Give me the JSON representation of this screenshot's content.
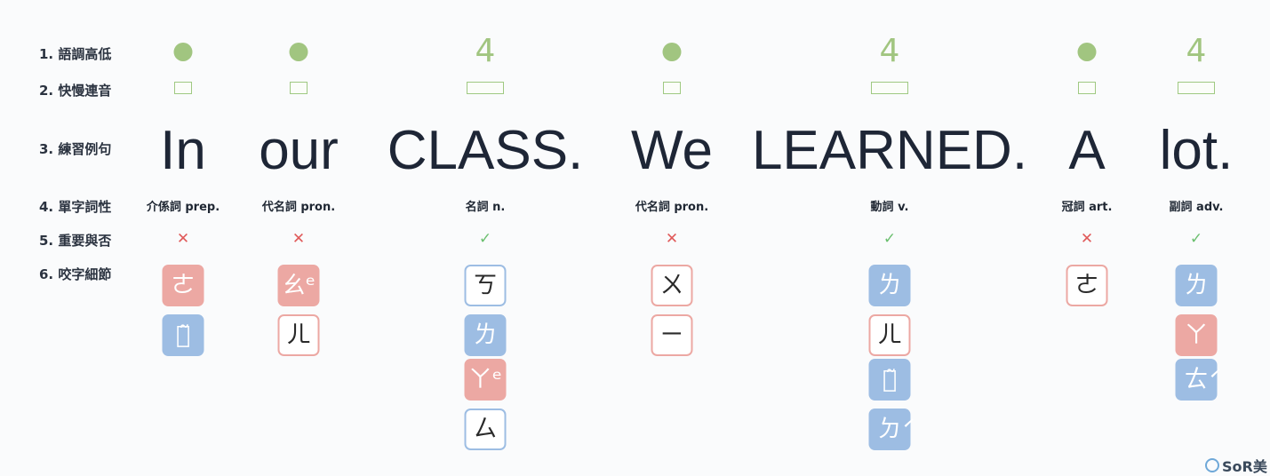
{
  "rows": [
    {
      "label": "1. 語調高低"
    },
    {
      "label": "2. 快慢連音"
    },
    {
      "label": "3. 練習例句"
    },
    {
      "label": "4. 單字詞性"
    },
    {
      "label": "5. 重要與否"
    },
    {
      "label": "6. 咬字細節"
    }
  ],
  "colors": {
    "green": "#a1c580",
    "pink": "#eca8a3",
    "blue": "#9dbde3",
    "cross": "#e05a5a",
    "check": "#6bbf6f"
  },
  "words": [
    {
      "word": "In",
      "tone": "dot",
      "pos": "介係詞 prep.",
      "important": false,
      "mark": "✕",
      "tiles": [
        {
          "char": "ㄜ",
          "style": "pink"
        },
        {
          "char": "ㄋ̃",
          "style": "blue"
        }
      ]
    },
    {
      "word": "our",
      "tone": "dot",
      "pos": "代名詞 pron.",
      "important": false,
      "mark": "✕",
      "tiles": [
        {
          "char": "ㄠᵉ",
          "style": "pink"
        },
        {
          "char": "ㄦ",
          "style": "out-pink"
        }
      ]
    },
    {
      "word": "CLASS.",
      "tone": "4",
      "pos": "名詞 n.",
      "important": true,
      "mark": "✓",
      "tiles": [
        {
          "char": "ㄎ",
          "style": "out-blue"
        },
        {
          "char": "ㄌ",
          "style": "blue"
        },
        {
          "char": "ㄚᵉ",
          "style": "pink"
        },
        {
          "char": "ㄙ",
          "style": "out-blue"
        }
      ]
    },
    {
      "word": "We",
      "tone": "dot",
      "pos": "代名詞 pron.",
      "important": false,
      "mark": "✕",
      "tiles": [
        {
          "char": "ㄨ",
          "style": "out-pink"
        },
        {
          "char": "ㄧ",
          "style": "out-pink"
        }
      ]
    },
    {
      "word": "LEARNED.",
      "tone": "4",
      "pos": "動詞 v.",
      "important": true,
      "mark": "✓",
      "tiles": [
        {
          "char": "ㄌ",
          "style": "blue"
        },
        {
          "char": "ㄦ",
          "style": "out-pink"
        },
        {
          "char": "ㄋ̃",
          "style": "blue"
        },
        {
          "char": "ㄉ́",
          "style": "blue"
        }
      ]
    },
    {
      "word": "A",
      "tone": "dot",
      "pos": "冠詞 art.",
      "important": false,
      "mark": "✕",
      "tiles": [
        {
          "char": "ㄜ",
          "style": "out-pink"
        }
      ]
    },
    {
      "word": "lot.",
      "tone": "4",
      "pos": "副詞 adv.",
      "important": true,
      "mark": "✓",
      "tiles": [
        {
          "char": "ㄌ",
          "style": "blue"
        },
        {
          "char": "ㄚ",
          "style": "pink"
        },
        {
          "char": "ㄊ́",
          "style": "blue"
        }
      ]
    }
  ],
  "logo": {
    "text": "SoR美"
  }
}
